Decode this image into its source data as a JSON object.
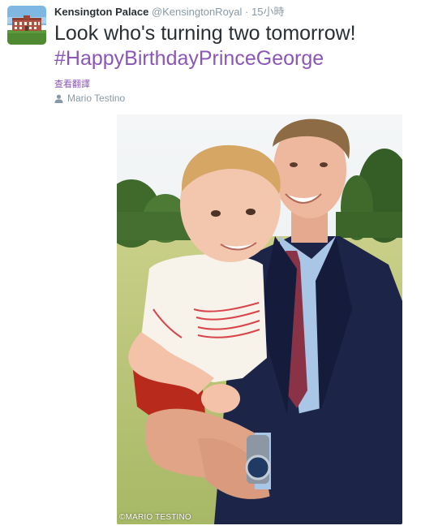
{
  "tweet": {
    "fullname": "Kensington Palace",
    "username": "@KensingtonRoyal",
    "separator": "·",
    "timestamp": "15小時",
    "text": "Look who's turning two tomorrow!",
    "hashtag": "#HappyBirthdayPrinceGeorge",
    "translate_label": "查看翻譯",
    "photo_credit": "Mario Testino"
  },
  "media": {
    "watermark": "©MARIO TESTINO"
  },
  "icons": {
    "credit": "person-icon"
  },
  "colors": {
    "accent": "#8b55b9",
    "secondary_text": "#8899a6",
    "primary_text": "#292f33"
  }
}
